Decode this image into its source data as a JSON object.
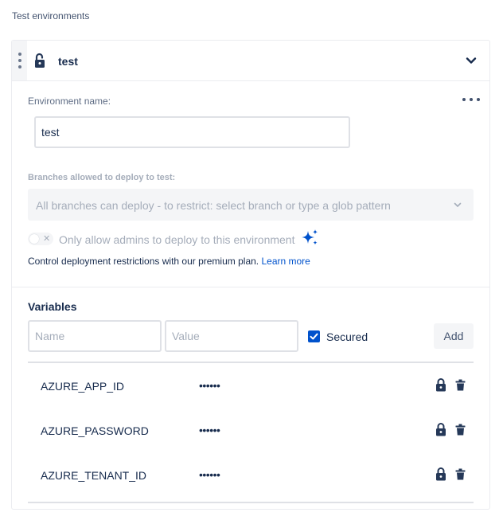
{
  "section_title": "Test environments",
  "environment": {
    "title": "test",
    "name_label": "Environment name:",
    "name_value": "test"
  },
  "branches": {
    "label": "Branches allowed to deploy to test:",
    "select_text": "All branches can deploy - to restrict: select branch or type a glob pattern"
  },
  "admin_toggle": {
    "off_symbol": "✕",
    "label": "Only allow admins to deploy to this environment"
  },
  "premium": {
    "text": "Control deployment restrictions with our premium plan. ",
    "link": "Learn more"
  },
  "variables": {
    "title": "Variables",
    "name_placeholder": "Name",
    "value_placeholder": "Value",
    "secured_label": "Secured",
    "add_label": "Add",
    "rows": [
      {
        "name": "AZURE_APP_ID",
        "value": "••••••"
      },
      {
        "name": "AZURE_PASSWORD",
        "value": "••••••"
      },
      {
        "name": "AZURE_TENANT_ID",
        "value": "••••••"
      }
    ]
  },
  "colors": {
    "primary": "#0052cc",
    "text": "#172b4d",
    "muted": "#a5adba",
    "border": "#dfe1e6"
  }
}
